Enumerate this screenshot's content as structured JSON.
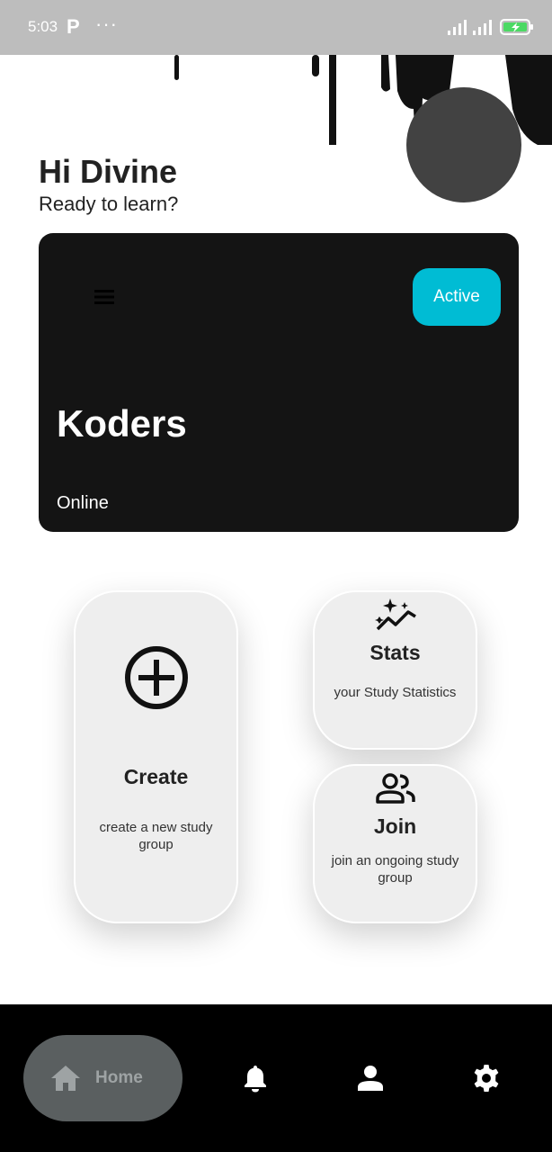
{
  "status_bar": {
    "time": "5:03",
    "app_letter": "P",
    "more": "···",
    "battery_color": "#4cd964"
  },
  "header": {
    "greeting": "Hi Divine",
    "subtitle": "Ready to learn?"
  },
  "group_card": {
    "badge": "Active",
    "name": "Koders",
    "status": "Online",
    "badge_color": "#00bcd4"
  },
  "tiles": {
    "create": {
      "icon": "add-circle-icon",
      "title": "Create",
      "description": "create a new study group"
    },
    "stats": {
      "icon": "insights-icon",
      "title": "Stats",
      "description": "your Study Statistics"
    },
    "join": {
      "icon": "group-icon",
      "title": "Join",
      "description": "join an ongoing study group"
    }
  },
  "bottom_nav": {
    "items": [
      {
        "icon": "home-icon",
        "label": "Home",
        "selected": true
      },
      {
        "icon": "bell-icon",
        "label": ""
      },
      {
        "icon": "person-icon",
        "label": ""
      },
      {
        "icon": "gear-icon",
        "label": ""
      }
    ]
  }
}
